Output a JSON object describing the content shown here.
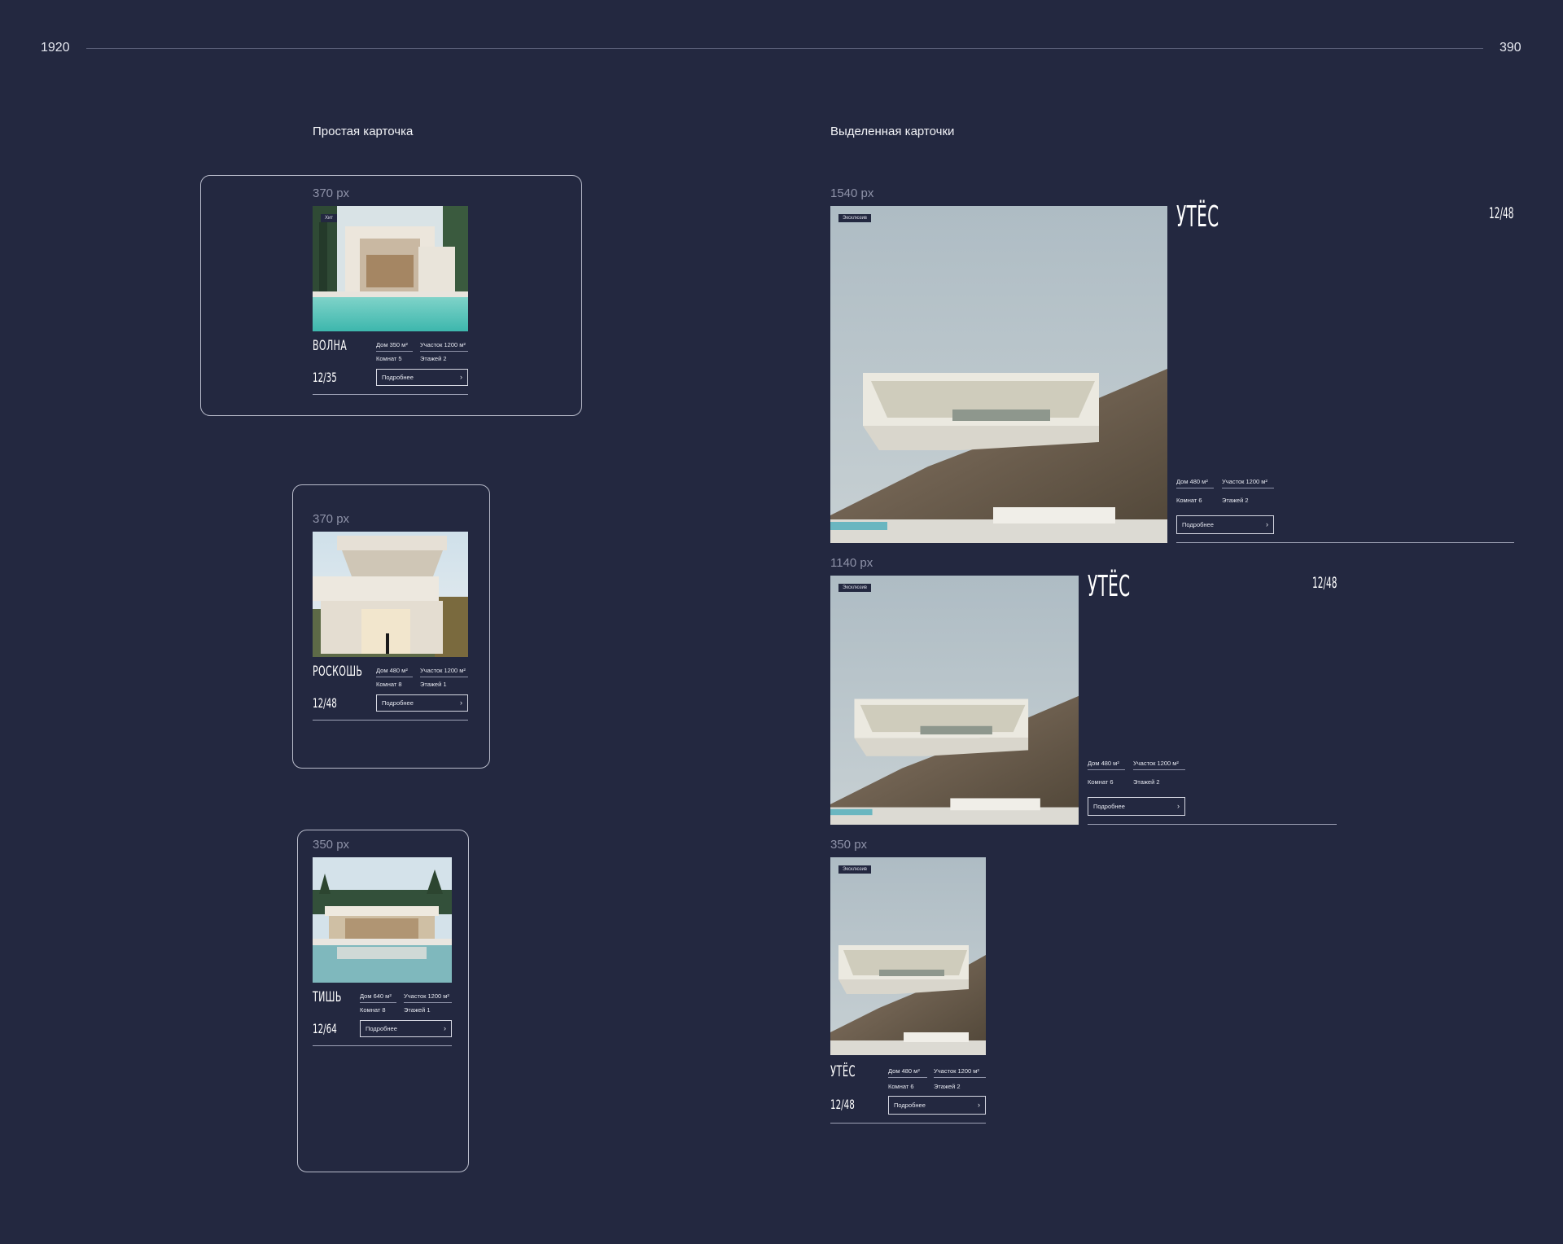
{
  "ruler": {
    "left": "1920",
    "right": "390"
  },
  "sections": {
    "simple": "Простая карточка",
    "featured": "Выделенная карточки"
  },
  "common": {
    "more_label": "Подробнее",
    "chevron": "›",
    "exclusive_badge": "Эксклюзив"
  },
  "simple_cards": [
    {
      "size": "370 px",
      "badge": "Хит",
      "name": "ВОЛНА",
      "num": "12/35",
      "house": "Дом  350 м²",
      "plot": "Участок  1200 м²",
      "rooms": "Комнат  5",
      "floors": "Этажей  2"
    },
    {
      "size": "370 px",
      "name": "РОСКОШЬ",
      "num": "12/48",
      "house": "Дом  480 м²",
      "plot": "Участок  1200 м²",
      "rooms": "Комнат  8",
      "floors": "Этажей  1"
    },
    {
      "size": "350 px",
      "name": "ТИШЬ",
      "num": "12/64",
      "house": "Дом  640 м²",
      "plot": "Участок  1200 м²",
      "rooms": "Комнат  8",
      "floors": "Этажей  1"
    }
  ],
  "featured_cards": [
    {
      "size": "1540 px",
      "name": "УТЁС",
      "num": "12/48",
      "house": "Дом  480 м²",
      "plot": "Участок  1200 м²",
      "rooms": "Комнат  6",
      "floors": "Этажей  2"
    },
    {
      "size": "1140 px",
      "name": "УТЁС",
      "num": "12/48",
      "house": "Дом  480 м²",
      "plot": "Участок  1200 м²",
      "rooms": "Комнат  6",
      "floors": "Этажей  2"
    },
    {
      "size": "350 px",
      "name": "УТЁС",
      "num": "12/48",
      "house": "Дом  480 м²",
      "plot": "Участок  1200 м²",
      "rooms": "Комнат  6",
      "floors": "Этажей  2"
    }
  ],
  "colors": {
    "background": "#232840",
    "frame": "#b9bccb",
    "muted": "#8e92a8"
  }
}
